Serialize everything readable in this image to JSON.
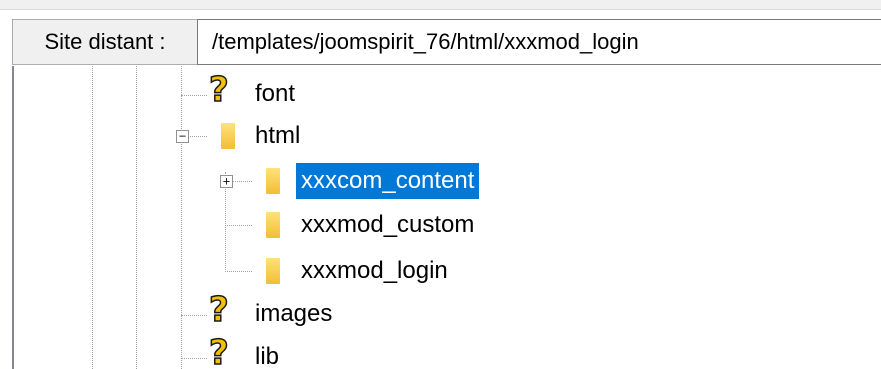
{
  "path_bar": {
    "label": "Site distant :",
    "value": "/templates/joomspirit_76/html/xxxmod_login"
  },
  "tree": {
    "nodes": [
      {
        "label": "font",
        "icon": "question-mark-icon"
      },
      {
        "label": "html",
        "icon": "folder-icon",
        "expander": "−"
      },
      {
        "label": "xxxcom_content",
        "icon": "folder-icon",
        "expander": "+",
        "selected": true
      },
      {
        "label": "xxxmod_custom",
        "icon": "folder-icon"
      },
      {
        "label": "xxxmod_login",
        "icon": "folder-icon"
      },
      {
        "label": "images",
        "icon": "question-mark-icon"
      },
      {
        "label": "lib",
        "icon": "question-mark-icon"
      }
    ],
    "question_glyph": "?"
  },
  "colors": {
    "selection": "#0078d7",
    "folder": "#f3bd35",
    "question": "#f2c100"
  }
}
